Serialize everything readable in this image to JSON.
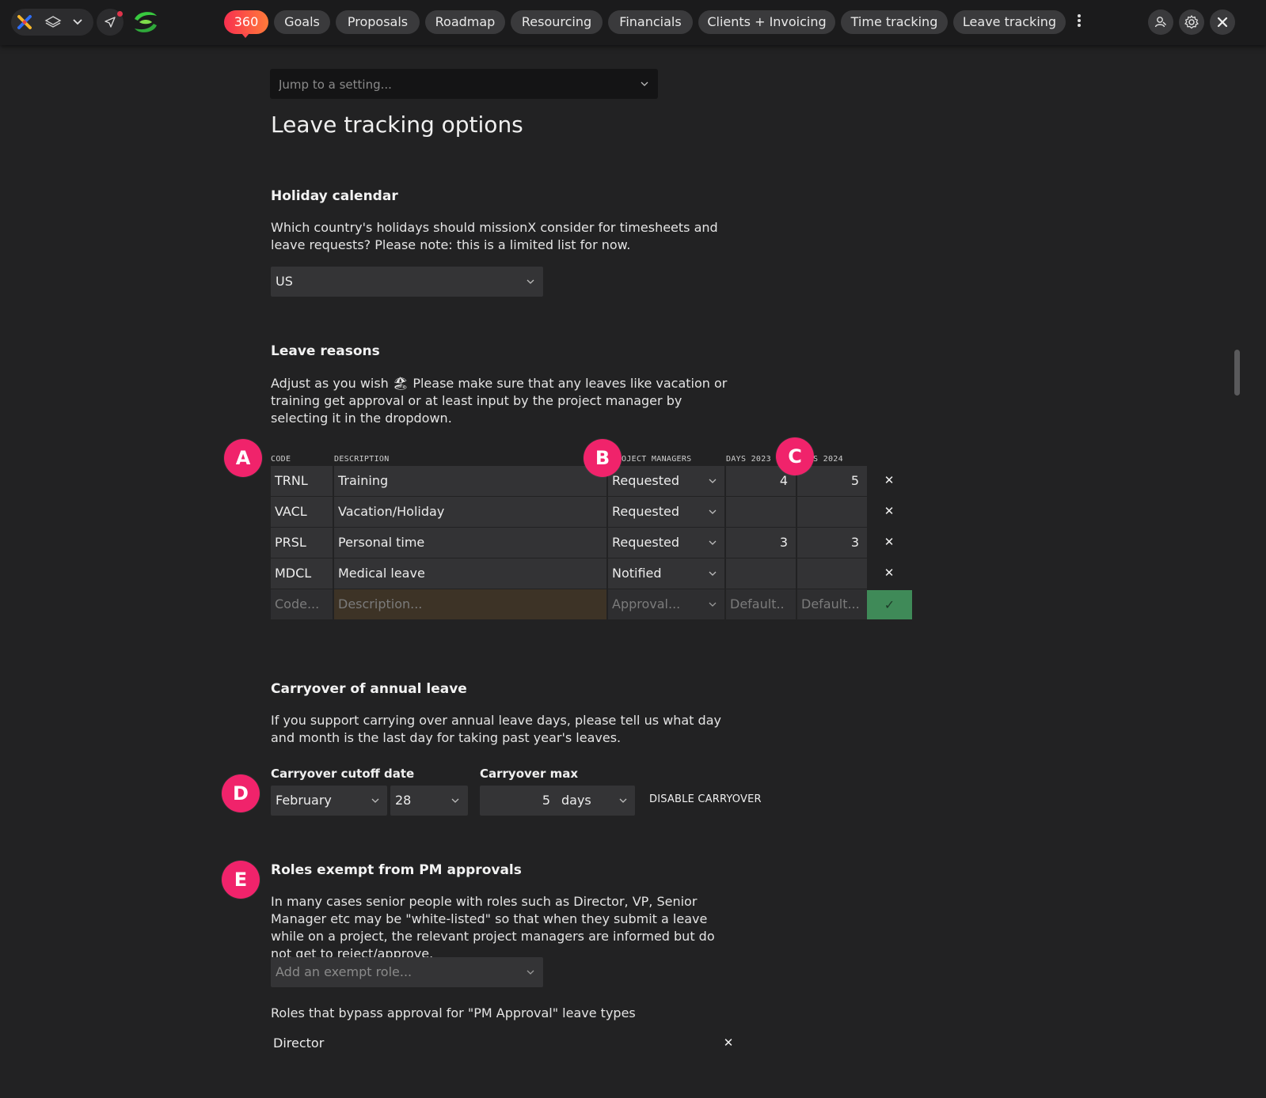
{
  "topbar": {
    "icons": {
      "logo": "missionx-logo-icon",
      "layers": "layers-icon",
      "dropdown": "chevron-down-icon",
      "send": "send-icon",
      "brand": "swirl-brand-icon",
      "more": "kebab-menu-icon",
      "user": "user-search-icon",
      "settings": "gear-icon",
      "close": "close-icon"
    },
    "tabs": [
      {
        "label": "360"
      },
      {
        "label": "Goals"
      },
      {
        "label": "Proposals"
      },
      {
        "label": "Roadmap"
      },
      {
        "label": "Resourcing"
      },
      {
        "label": "Financials"
      },
      {
        "label": "Clients + Invoicing"
      },
      {
        "label": "Time tracking"
      },
      {
        "label": "Leave tracking"
      }
    ],
    "accent_gradient": [
      "#f8304f",
      "#ff7a3a"
    ]
  },
  "jump": {
    "placeholder": "Jump to a setting..."
  },
  "page_title": "Leave tracking options",
  "holiday": {
    "heading": "Holiday calendar",
    "description": "Which country's holidays should missionX consider for timesheets and leave requests? Please note: this is a limited list for now.",
    "selected": "US"
  },
  "leave_reasons": {
    "heading": "Leave reasons",
    "description_before": "Adjust as you wish",
    "emoji": "🏖",
    "description_after": "Please make sure that any leaves like vacation or training get approval or at least input by the project manager by selecting it in the dropdown.",
    "columns": {
      "code": "CODE",
      "description": "DESCRIPTION",
      "pm": "OJECT MANAGERS",
      "days2023": "DAYS 2023",
      "days2024": "S 2024"
    },
    "rows": [
      {
        "code": "TRNL",
        "description": "Training",
        "approval": "Requested",
        "days_2023": "4",
        "days_2024": "5"
      },
      {
        "code": "VACL",
        "description": "Vacation/Holiday",
        "approval": "Requested",
        "days_2023": "",
        "days_2024": ""
      },
      {
        "code": "PRSL",
        "description": "Personal time",
        "approval": "Requested",
        "days_2023": "3",
        "days_2024": "3"
      },
      {
        "code": "MDCL",
        "description": "Medical leave",
        "approval": "Notified",
        "days_2023": "",
        "days_2024": ""
      }
    ],
    "new_row": {
      "code_placeholder": "Code...",
      "description_placeholder": "Description...",
      "approval_placeholder": "Approval...",
      "days_2023_placeholder": "Default..",
      "days_2024_placeholder": "Default..."
    },
    "delete_glyph": "✕",
    "confirm_glyph": "✓",
    "confirm_color": "#3f8a58"
  },
  "carryover": {
    "heading": "Carryover of annual leave",
    "description": "If you support carrying over annual leave days, please tell us what day and month is the last day for taking past year's leaves.",
    "cutoff_label": "Carryover cutoff date",
    "month": "February",
    "day": "28",
    "max_label": "Carryover max",
    "max_value": "5",
    "unit": "days",
    "disable_label": "DISABLE CARRYOVER"
  },
  "exempt": {
    "heading": "Roles exempt from PM approvals",
    "description": "In many cases senior people with roles such as Director, VP, Senior Manager etc may be \"white-listed\" so that when they submit a leave while on a project, the relevant project managers are informed but do not get to reject/approve.",
    "add_placeholder": "Add an exempt role...",
    "bypass_label": "Roles that bypass approval for \"PM Approval\" leave types",
    "roles": [
      "Director"
    ],
    "remove_glyph": "✕"
  },
  "badges": {
    "a": "A",
    "b": "B",
    "c": "C",
    "d": "D",
    "e": "E",
    "color": "#f0236b"
  }
}
